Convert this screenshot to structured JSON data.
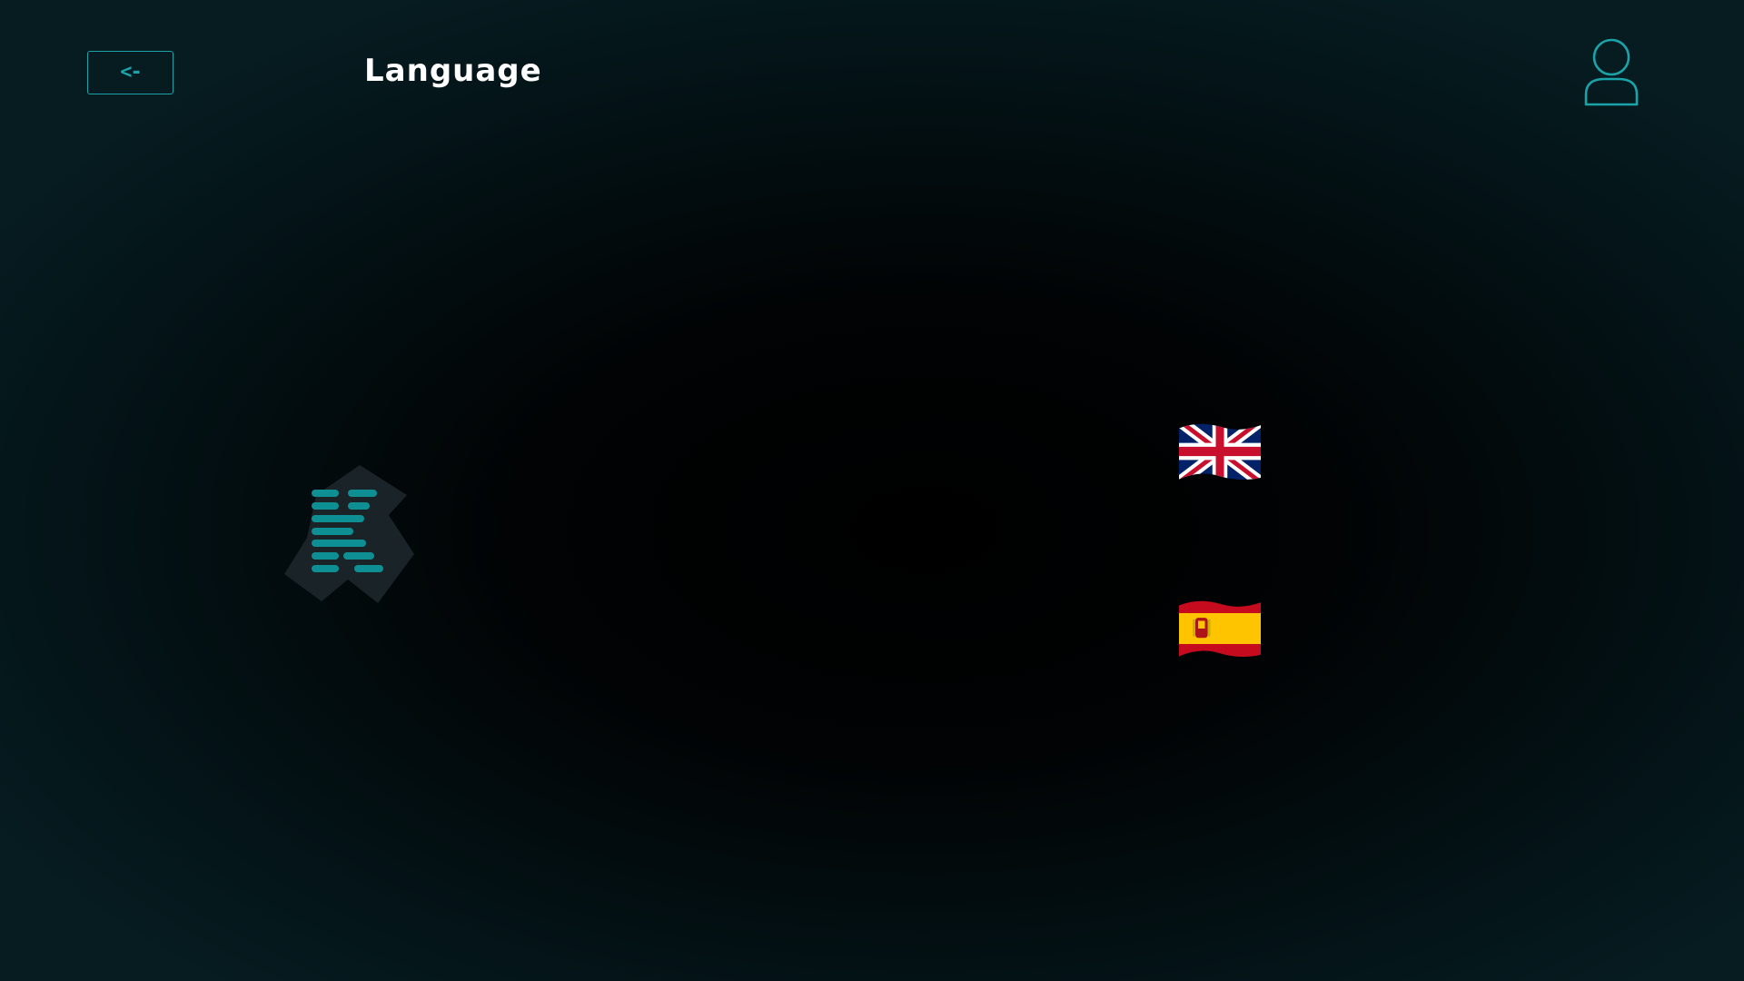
{
  "header": {
    "back_button": {
      "label": "<-"
    },
    "title": "Language",
    "user_icon": "user-profile-icon"
  },
  "logo": {
    "icon": "app-logo-icon"
  },
  "languages": [
    {
      "flag": "uk-flag-icon"
    },
    {
      "flag": "spain-flag-icon"
    }
  ],
  "colors": {
    "accent": "#1aa3a8",
    "logo_bars": "#0d8f93",
    "logo_shape": "#1a2328",
    "background_edge": "#061c21",
    "background_center": "#000000",
    "title": "#ffffff"
  }
}
